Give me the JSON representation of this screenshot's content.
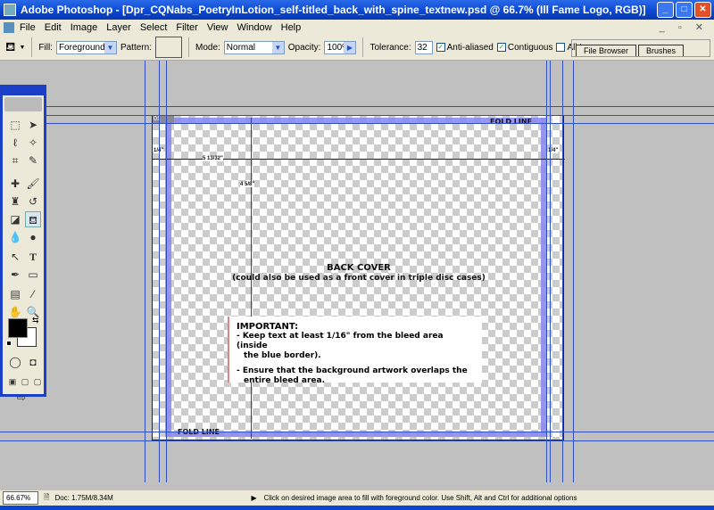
{
  "window": {
    "title": "Adobe Photoshop - [Dpr_CQNabs_PoetryInLotion_self-titled_back_with_spine_textnew.psd @ 66.7% (Ill Fame Logo, RGB)]"
  },
  "menu": [
    "File",
    "Edit",
    "Image",
    "Layer",
    "Select",
    "Filter",
    "View",
    "Window",
    "Help"
  ],
  "options": {
    "fill_label": "Fill:",
    "fill_value": "Foreground",
    "pattern_label": "Pattern:",
    "mode_label": "Mode:",
    "mode_value": "Normal",
    "opacity_label": "Opacity:",
    "opacity_value": "100%",
    "tolerance_label": "Tolerance:",
    "tolerance_value": "32",
    "anti_aliased": "Anti-aliased",
    "anti_aliased_checked": true,
    "contiguous": "Contiguous",
    "contiguous_checked": true,
    "all_layers": "All Layers",
    "all_layers_checked": false
  },
  "palette_tabs": [
    "File Browser",
    "Brushes"
  ],
  "document": {
    "layer_badge": "01",
    "fold_line_top": "FOLD LINE",
    "fold_line_bottom": "FOLD LINE",
    "dim_left": "1/4\"",
    "dim_right": "1/4\"",
    "dim_width": "5 13/32\"",
    "dim_height": "4 5/8\"",
    "title": "BACK COVER",
    "subtitle": "(could also be used as a front cover in triple disc cases)",
    "important_heading": "IMPORTANT:",
    "important_line1": "- Keep text at least 1/16\" from the bleed area (inside",
    "important_line1b": "the blue border).",
    "important_line2": "- Ensure that the background artwork overlaps the",
    "important_line2b": "entire bleed area."
  },
  "status": {
    "zoom": "66.67%",
    "doc": "Doc: 1.75M/8.34M",
    "hint": "Click on desired image area to fill with foreground color.  Use Shift, Alt and Ctrl for additional options"
  },
  "colors": {
    "foreground": "#000000",
    "background": "#ffffff",
    "bleed": "#8c8cf0",
    "guide": "#3050c8"
  }
}
